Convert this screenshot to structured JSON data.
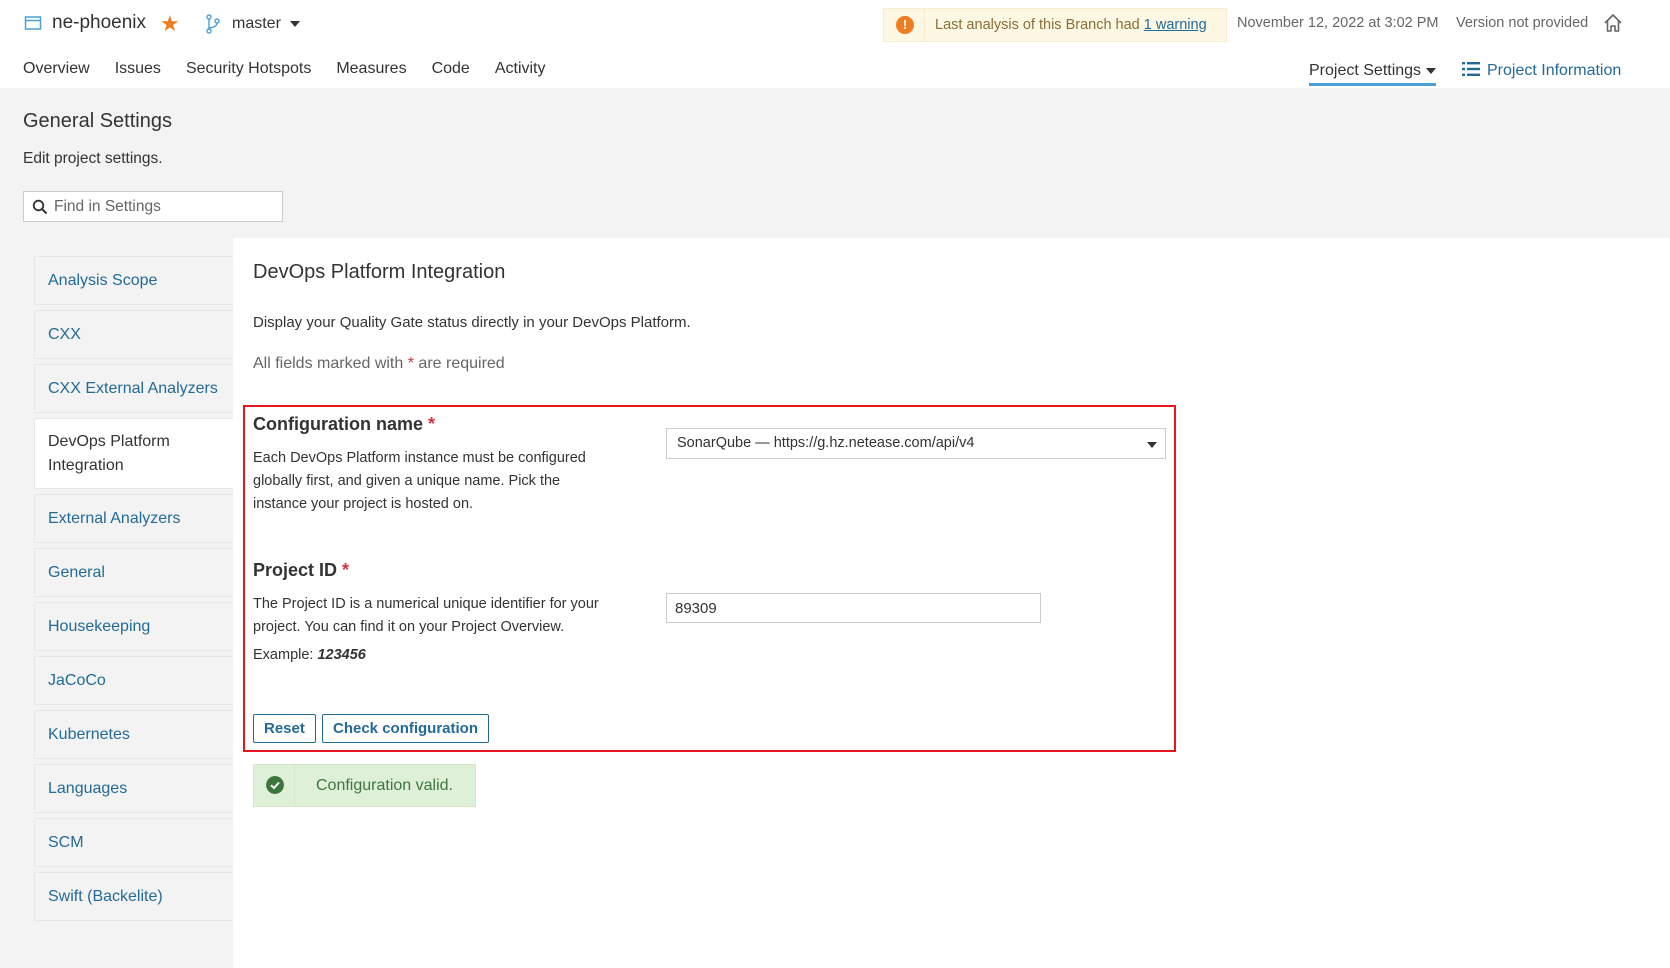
{
  "project": {
    "name": "ne-phoenix",
    "branch": "master"
  },
  "warning": {
    "text": "Last analysis of this Branch had",
    "link": "1 warning"
  },
  "analysis_date": "November 12, 2022 at 3:02 PM",
  "version": "Version not provided",
  "nav": {
    "items": [
      "Overview",
      "Issues",
      "Security Hotspots",
      "Measures",
      "Code",
      "Activity"
    ],
    "settings": "Project Settings",
    "info": "Project Information"
  },
  "header": {
    "title": "General Settings",
    "description": "Edit project settings.",
    "search_placeholder": "Find in Settings"
  },
  "sidebar": {
    "items": [
      {
        "label": "Analysis Scope",
        "active": false
      },
      {
        "label": "CXX",
        "active": false
      },
      {
        "label": "CXX External Analyzers",
        "active": false
      },
      {
        "label": "DevOps Platform Integration",
        "active": true
      },
      {
        "label": "External Analyzers",
        "active": false
      },
      {
        "label": "General",
        "active": false
      },
      {
        "label": "Housekeeping",
        "active": false
      },
      {
        "label": "JaCoCo",
        "active": false
      },
      {
        "label": "Kubernetes",
        "active": false
      },
      {
        "label": "Languages",
        "active": false
      },
      {
        "label": "SCM",
        "active": false
      },
      {
        "label": "Swift (Backelite)",
        "active": false
      }
    ]
  },
  "main": {
    "title": "DevOps Platform Integration",
    "description": "Display your Quality Gate status directly in your DevOps Platform.",
    "required_note_before": "All fields marked with",
    "required_star": "*",
    "required_note_after": "are required",
    "config": {
      "label": "Configuration name",
      "help": "Each DevOps Platform instance must be configured globally first, and given a unique name. Pick the instance your project is hosted on.",
      "value": "SonarQube — https://g.hz.netease.com/api/v4"
    },
    "project_id": {
      "label": "Project ID",
      "help": "The Project ID is a numerical unique identifier for your project. You can find it on your Project Overview.",
      "example_label": "Example:",
      "example_value": "123456",
      "value": "89309"
    },
    "reset_button": "Reset",
    "check_button": "Check configuration",
    "success_message": "Configuration valid."
  },
  "colors": {
    "link": "#236a97",
    "accent": "#4b9fd5",
    "star": "#ed7d20",
    "required": "#d4333f",
    "highlight": "#e8151c",
    "success": "#3c763d"
  }
}
